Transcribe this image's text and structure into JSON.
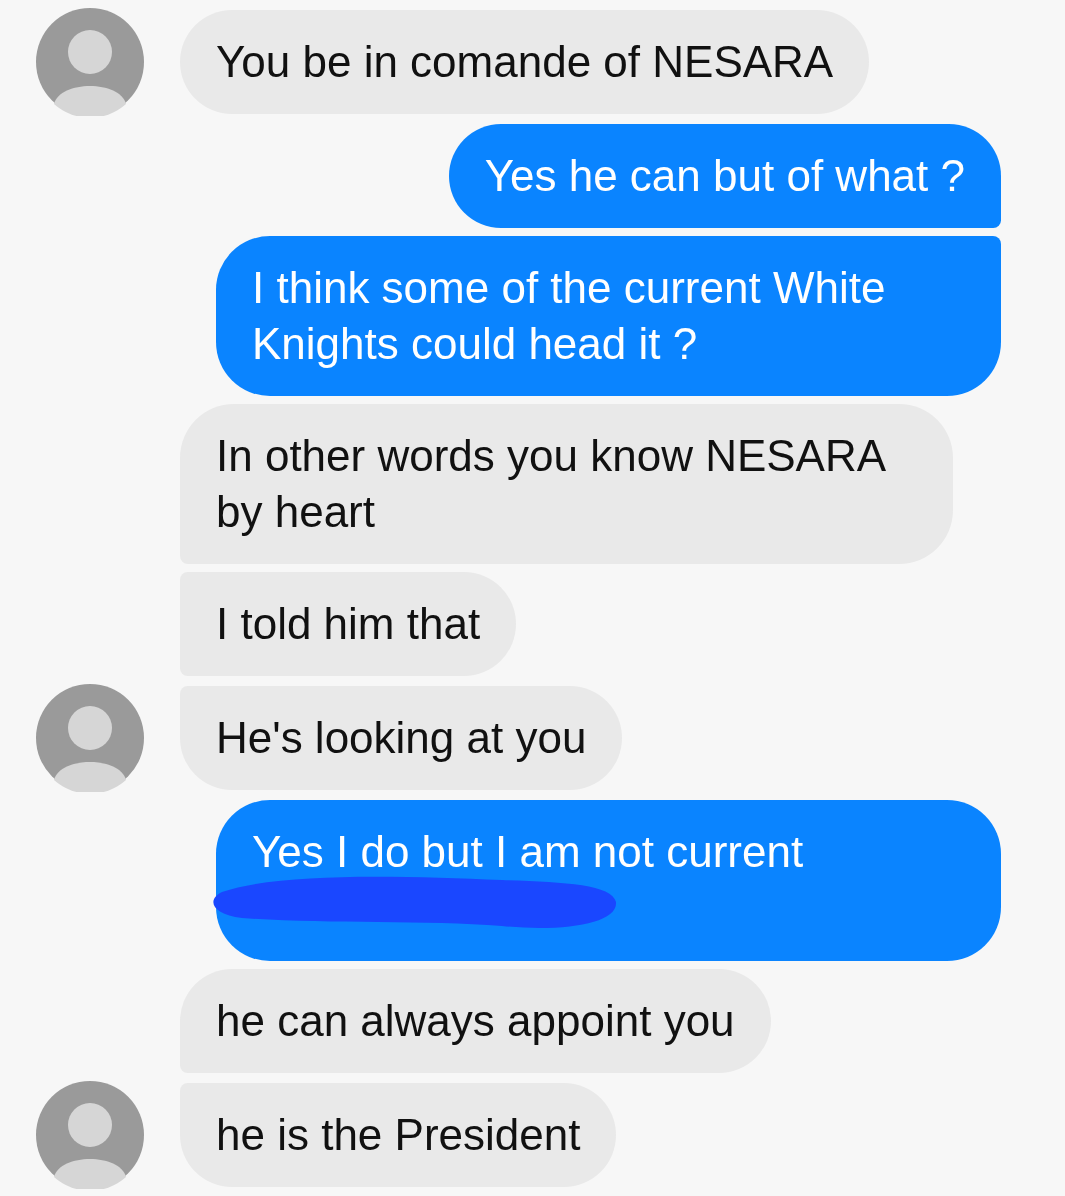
{
  "messages": [
    {
      "kind": "incoming",
      "text": "You be in comande of NESARA",
      "avatar": true,
      "redacted": false
    },
    {
      "kind": "outgoing",
      "text": "Yes he can but of what ?",
      "redacted": false
    },
    {
      "kind": "outgoing",
      "text": "I think some of the current White Knights could head it ?",
      "redacted": false
    },
    {
      "kind": "incoming",
      "text": "In other words you know NESARA by heart",
      "avatar": false,
      "redacted": false
    },
    {
      "kind": "incoming",
      "text": "I told him that",
      "avatar": false,
      "redacted": false
    },
    {
      "kind": "incoming",
      "text": "He's looking at you",
      "avatar": true,
      "redacted": false
    },
    {
      "kind": "outgoing",
      "text": "Yes I do but I am not current",
      "redacted": true
    },
    {
      "kind": "incoming",
      "text": "he can always appoint you",
      "avatar": false,
      "redacted": false
    },
    {
      "kind": "incoming",
      "text": "he is the President",
      "avatar": true,
      "redacted": false
    }
  ]
}
